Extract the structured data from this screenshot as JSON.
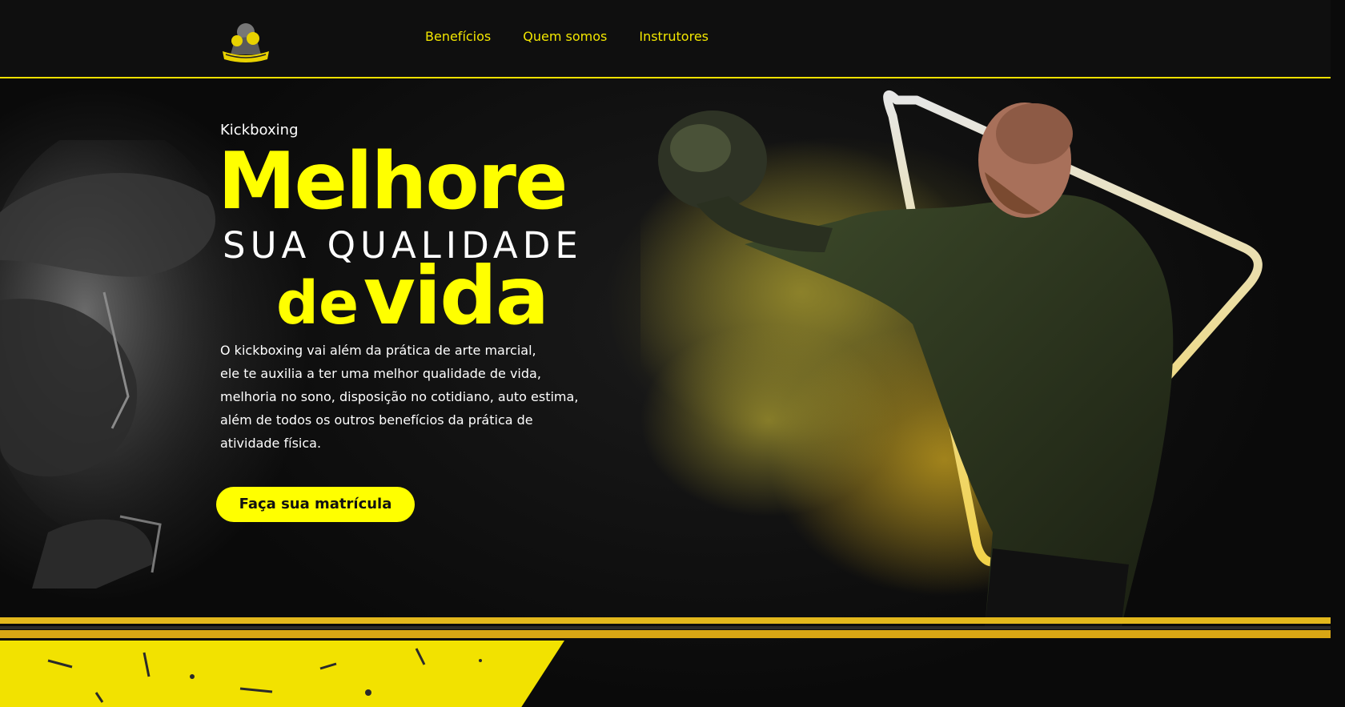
{
  "header": {
    "nav": [
      {
        "label": "Benefícios"
      },
      {
        "label": "Quem somos"
      },
      {
        "label": "Instrutores"
      }
    ]
  },
  "hero": {
    "eyebrow": "Kickboxing",
    "headline_line1": "Melhore",
    "headline_line2": "SUA QUALIDADE",
    "headline_line3_a": "de",
    "headline_line3_b": "vida",
    "description_lines": [
      "O kickboxing vai além da prática de arte marcial,",
      "ele te auxilia a ter uma melhor qualidade de vida,",
      "melhoria no sono, disposição no cotidiano, auto estima,",
      "além de todos os outros benefícios da prática de",
      "atividade física."
    ],
    "cta_label": "Faça sua matrícula"
  },
  "colors": {
    "accent": "#ffff00",
    "nav_text": "#f2e600",
    "background": "#0d0d0d",
    "text": "#ffffff"
  },
  "icons": {
    "logo": "boxer-logo-icon",
    "play": "play-triangle-icon"
  }
}
